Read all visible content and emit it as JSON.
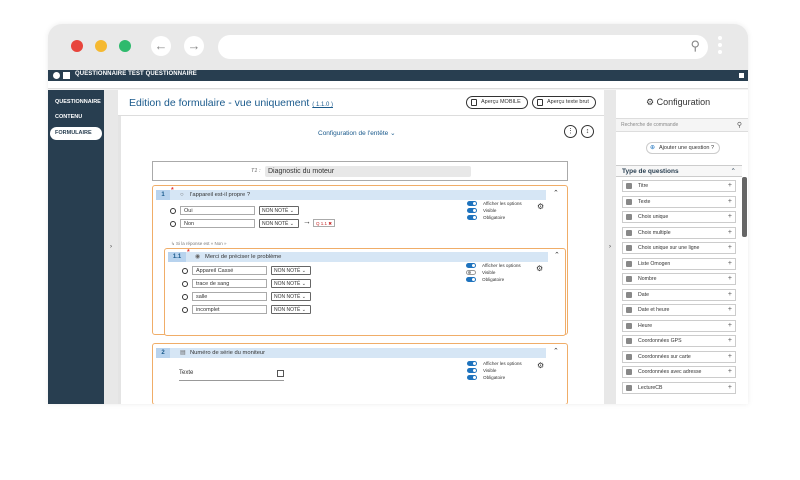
{
  "app": {
    "title": "QUESTIONNAIRE TEST QUESTIONNAIRE"
  },
  "sidebar": {
    "items": [
      {
        "label": "QUESTIONNAIRE"
      },
      {
        "label": "CONTENU"
      },
      {
        "label": "FORMULAIRE",
        "active": true
      }
    ]
  },
  "header": {
    "title": "Edition de formulaire - vue uniquement",
    "version": "( 1.1.0 )",
    "btn_mobile": "Aperçu MOBILE",
    "btn_text": "Aperçu texte brut",
    "config": "Configuration de l'entête"
  },
  "form_title": {
    "label": "T1 :",
    "value": "Diagnostic du moteur"
  },
  "questions": [
    {
      "num": "1",
      "text": "l'appareil est-il propre ?",
      "options": [
        {
          "label": "Oui",
          "score": "NON NOTÉ"
        },
        {
          "label": "Non",
          "score": "NON NOTÉ",
          "target": "Q 1.1"
        }
      ],
      "toggles": [
        "Afficher les options",
        "Visible",
        "Obligatoire"
      ]
    },
    {
      "num": "1.1",
      "condition": "Si la réponse est « Non »",
      "text": "Merci de préciser le problème",
      "options": [
        {
          "label": "Appareil Cassé",
          "score": "NON NOTÉ"
        },
        {
          "label": "trace de sang",
          "score": "NON NOTÉ"
        },
        {
          "label": "salle",
          "score": "NON NOTÉ"
        },
        {
          "label": "incomplet",
          "score": "NON NOTÉ"
        }
      ],
      "toggles": [
        "Afficher les options",
        "Visible",
        "Obligatoire"
      ]
    },
    {
      "num": "2",
      "text": "Numéro de série du moniteur",
      "field": "Texte",
      "toggles": [
        "Afficher les options",
        "Visible",
        "Obligatoire"
      ]
    }
  ],
  "right_panel": {
    "title": "Configuration",
    "search_placeholder": "Recherche de commande",
    "add_question": "Ajouter une question ?",
    "types_header": "Type de questions",
    "types": [
      "Titre",
      "Texte",
      "Choix unique",
      "Choix multiple",
      "Choix unique sur une ligne",
      "Liste Omogen",
      "Nombre",
      "Date",
      "Date et heure",
      "Heure",
      "Coordonnées GPS",
      "Coordonnées sur carte",
      "Coordonnées avec adresse",
      "LectureCB"
    ]
  }
}
